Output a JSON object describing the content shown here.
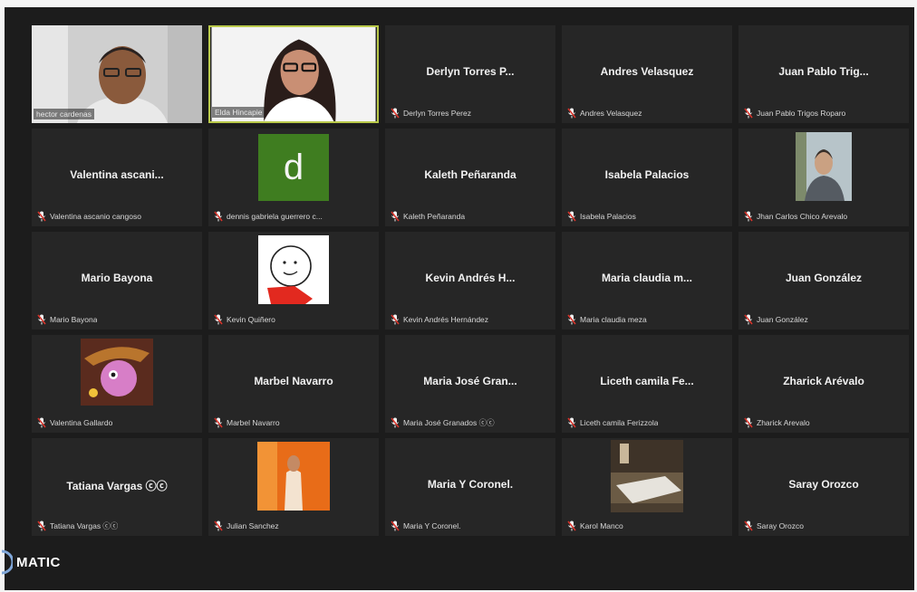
{
  "brand": {
    "text": "MATIC",
    "logo_icon": "brand-logo-icon"
  },
  "colors": {
    "background": "#1c1c1c",
    "tile": "#262626",
    "active_border": "#b9c94a",
    "mic_muted": "#d9342b"
  },
  "participants": [
    {
      "id": "p1",
      "type": "video",
      "label": "hector cardenas",
      "scene": "man-glasses"
    },
    {
      "id": "p2",
      "type": "video",
      "label": "Elda Hincapie",
      "scene": "woman-glasses",
      "active": true
    },
    {
      "id": "p3",
      "type": "name",
      "display": "Derlyn Torres P...",
      "label": "Derlyn Torres Perez",
      "muted": true
    },
    {
      "id": "p4",
      "type": "name",
      "display": "Andres Velasquez",
      "label": "Andres Velasquez",
      "muted": true
    },
    {
      "id": "p5",
      "type": "name",
      "display": "Juan Pablo Trig...",
      "label": "Juan Pablo Trigos Roparo",
      "muted": true
    },
    {
      "id": "p6",
      "type": "name",
      "display": "Valentina ascani...",
      "label": "Valentina ascanio cangoso",
      "muted": true
    },
    {
      "id": "p7",
      "type": "avatar",
      "avatar": "letter",
      "letter": "d",
      "label": "dennis gabriela guerrero c...",
      "muted": true
    },
    {
      "id": "p8",
      "type": "name",
      "display": "Kaleth Peñaranda",
      "label": "Kaleth Peñaranda",
      "muted": true
    },
    {
      "id": "p9",
      "type": "name",
      "display": "Isabela Palacios",
      "label": "Isabela Palacios",
      "muted": true
    },
    {
      "id": "p10",
      "type": "avatar",
      "avatar": "photo-man",
      "label": "Jhan Carlos Chico Arevalo",
      "muted": true
    },
    {
      "id": "p11",
      "type": "name",
      "display": "Mario Bayona",
      "label": "Mario Bayona",
      "muted": true
    },
    {
      "id": "p12",
      "type": "avatar",
      "avatar": "drawing",
      "label": "Kevin Quiñero",
      "muted": true
    },
    {
      "id": "p13",
      "type": "name",
      "display": "Kevin Andrés H...",
      "label": "Kevin Andrés Hernández",
      "muted": true
    },
    {
      "id": "p14",
      "type": "name",
      "display": "Maria claudia m...",
      "label": "Maria claudia meza",
      "muted": true
    },
    {
      "id": "p15",
      "type": "name",
      "display": "Juan González",
      "label": "Juan González",
      "muted": true
    },
    {
      "id": "p16",
      "type": "avatar",
      "avatar": "cartoon",
      "label": "Valentina Gallardo",
      "muted": true
    },
    {
      "id": "p17",
      "type": "name",
      "display": "Marbel Navarro",
      "label": "Marbel Navarro",
      "muted": true
    },
    {
      "id": "p18",
      "type": "name",
      "display": "Maria José Gran...",
      "label": "Maria José Granados ⓒⓒ",
      "muted": true
    },
    {
      "id": "p19",
      "type": "name",
      "display": "Liceth camila Fe...",
      "label": "Liceth camila Ferizzola",
      "muted": true
    },
    {
      "id": "p20",
      "type": "name",
      "display": "Zharick Arévalo",
      "label": "Zharick Arevalo",
      "muted": true
    },
    {
      "id": "p21",
      "type": "name",
      "display": "Tatiana Vargas ⓒⓒ",
      "label": "Tatiana Vargas ⓒⓒ",
      "muted": true
    },
    {
      "id": "p22",
      "type": "avatar",
      "avatar": "photo-orange",
      "label": "Julian Sanchez",
      "muted": true
    },
    {
      "id": "p23",
      "type": "name",
      "display": "Maria Y Coronel.",
      "label": "Maria Y Coronel.",
      "muted": true
    },
    {
      "id": "p24",
      "type": "avatar",
      "avatar": "photo-room",
      "label": "Karol Manco",
      "muted": true
    },
    {
      "id": "p25",
      "type": "name",
      "display": "Saray Orozco",
      "label": "Saray Orozco",
      "muted": true
    }
  ]
}
